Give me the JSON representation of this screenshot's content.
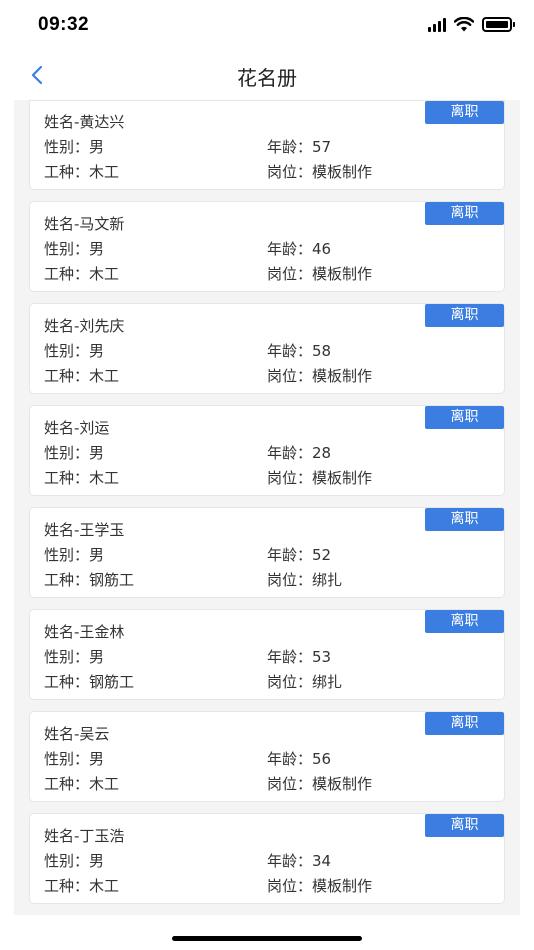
{
  "status_bar": {
    "time": "09:32"
  },
  "nav": {
    "title": "花名册"
  },
  "labels": {
    "name_prefix": "姓名-",
    "gender": "性别：",
    "age": "年龄：",
    "trade": "工种：",
    "post": "岗位："
  },
  "resign_label": "离职",
  "workers": [
    {
      "name": "黄达兴",
      "gender": "男",
      "age": "57",
      "trade": "木工",
      "post": "模板制作"
    },
    {
      "name": "马文新",
      "gender": "男",
      "age": "46",
      "trade": "木工",
      "post": "模板制作"
    },
    {
      "name": "刘先庆",
      "gender": "男",
      "age": "58",
      "trade": "木工",
      "post": "模板制作"
    },
    {
      "name": "刘运",
      "gender": "男",
      "age": "28",
      "trade": "木工",
      "post": "模板制作"
    },
    {
      "name": "王学玉",
      "gender": "男",
      "age": "52",
      "trade": "钢筋工",
      "post": "绑扎"
    },
    {
      "name": "王金林",
      "gender": "男",
      "age": "53",
      "trade": "钢筋工",
      "post": "绑扎"
    },
    {
      "name": "吴云",
      "gender": "男",
      "age": "56",
      "trade": "木工",
      "post": "模板制作"
    },
    {
      "name": "丁玉浩",
      "gender": "男",
      "age": "34",
      "trade": "木工",
      "post": "模板制作"
    }
  ]
}
